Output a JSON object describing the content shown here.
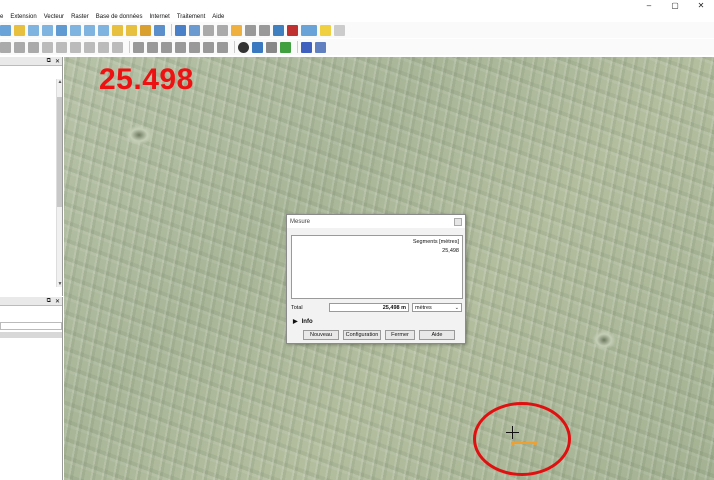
{
  "window": {
    "minimize": "–",
    "maximize": "▢",
    "close": "✕"
  },
  "menu": {
    "items": [
      "e",
      "Extension",
      "Vecteur",
      "Raster",
      "Base de données",
      "Internet",
      "Traitement",
      "Aide"
    ]
  },
  "map": {
    "measurement_display": "25.498"
  },
  "measure_dialog": {
    "title": "Mesure",
    "segments_header": "Segments [mètres]",
    "segment_values": [
      "25,498"
    ],
    "total_label": "Total",
    "total_value": "25,498 m",
    "unit": "mètres",
    "info_label": "Info",
    "buttons": {
      "new": "Nouveau",
      "config": "Configuration",
      "close": "Fermer",
      "help": "Aide"
    }
  },
  "colors": {
    "accent_red": "#ee1111",
    "map_green": "#b1bca2",
    "measure_line": "#f0a030"
  }
}
